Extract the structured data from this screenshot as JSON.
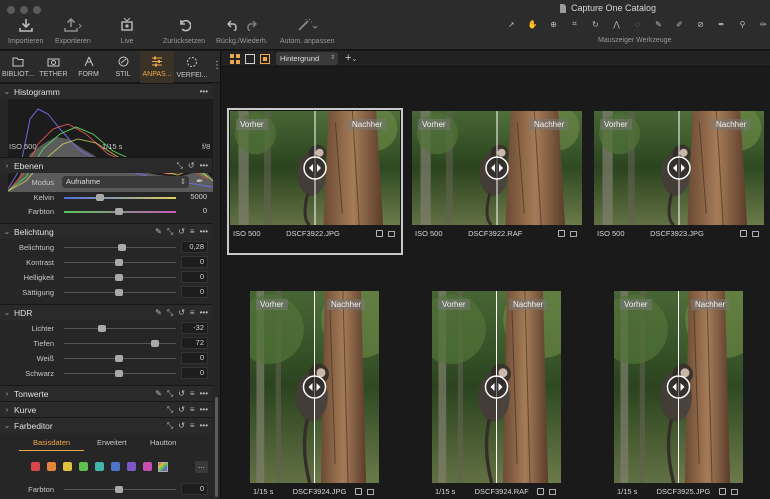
{
  "window": {
    "title": "Capture One Catalog"
  },
  "toolbar": {
    "import": "Importieren",
    "export": "Exportieren",
    "live": "Live",
    "reset": "Zurücksetzen",
    "undo_redo": "Rückg./Wiederh.",
    "auto_adjust": "Autom. anpassen",
    "cursor_tools": "Mauszeiger Werkzeuge"
  },
  "tool_tabs": [
    "BIBLIOT...",
    "TETHER",
    "FORM",
    "STIL",
    "ANPAS...",
    "VERFEI..."
  ],
  "histogram": {
    "title": "Histogramm",
    "iso": "ISO 500",
    "shutter": "1/15 s",
    "aperture": "f/8"
  },
  "layers": {
    "title": "Ebenen"
  },
  "white_balance": {
    "mode_label": "Modus",
    "mode_value": "Aufnahme",
    "kelvin_label": "Kelvin",
    "kelvin_value": "5000",
    "tint_label": "Farbton",
    "tint_value": "0"
  },
  "exposure": {
    "title": "Belichtung",
    "rows": [
      {
        "label": "Belichtung",
        "value": "0,28"
      },
      {
        "label": "Kontrast",
        "value": "0"
      },
      {
        "label": "Helligkeit",
        "value": "0"
      },
      {
        "label": "Sättigung",
        "value": "0"
      }
    ]
  },
  "hdr": {
    "title": "HDR",
    "rows": [
      {
        "label": "Lichter",
        "value": "-32"
      },
      {
        "label": "Tiefen",
        "value": "72"
      },
      {
        "label": "Weiß",
        "value": "0"
      },
      {
        "label": "Schwarz",
        "value": "0"
      }
    ]
  },
  "tonality": {
    "title": "Tonwerte"
  },
  "curve": {
    "title": "Kurve"
  },
  "color_editor": {
    "title": "Farbeditor",
    "tabs": [
      "Basisdaten",
      "Erweitert",
      "Hautton"
    ],
    "swatches": [
      "#d9474b",
      "#e6843a",
      "#e0c13f",
      "#5fc04f",
      "#3fb6a9",
      "#4d74c9",
      "#7a58c6",
      "#c44fae"
    ],
    "more": "...",
    "tint_label": "Farbton",
    "tint_value": "0"
  },
  "browser": {
    "group_by": "Hintergrund"
  },
  "thumbnails": [
    {
      "before": "Vorher",
      "after": "Nachher",
      "info": "ISO 500",
      "file": "DSCF3922.JPG"
    },
    {
      "before": "Vorher",
      "after": "Nachher",
      "info": "ISO 500",
      "file": "DSCF3922.RAF"
    },
    {
      "before": "Vorher",
      "after": "Nachher",
      "info": "ISO 500",
      "file": "DSCF3923.JPG"
    },
    {
      "before": "Vorher",
      "after": "Nachher",
      "info": "1/15 s",
      "file": "DSCF3924.JPG"
    },
    {
      "before": "Vorher",
      "after": "Nachher",
      "info": "1/15 s",
      "file": "DSCF3924.RAF"
    },
    {
      "before": "Vorher",
      "after": "Nachher",
      "info": "1/15 s",
      "file": "DSCF3925.JPG"
    }
  ]
}
